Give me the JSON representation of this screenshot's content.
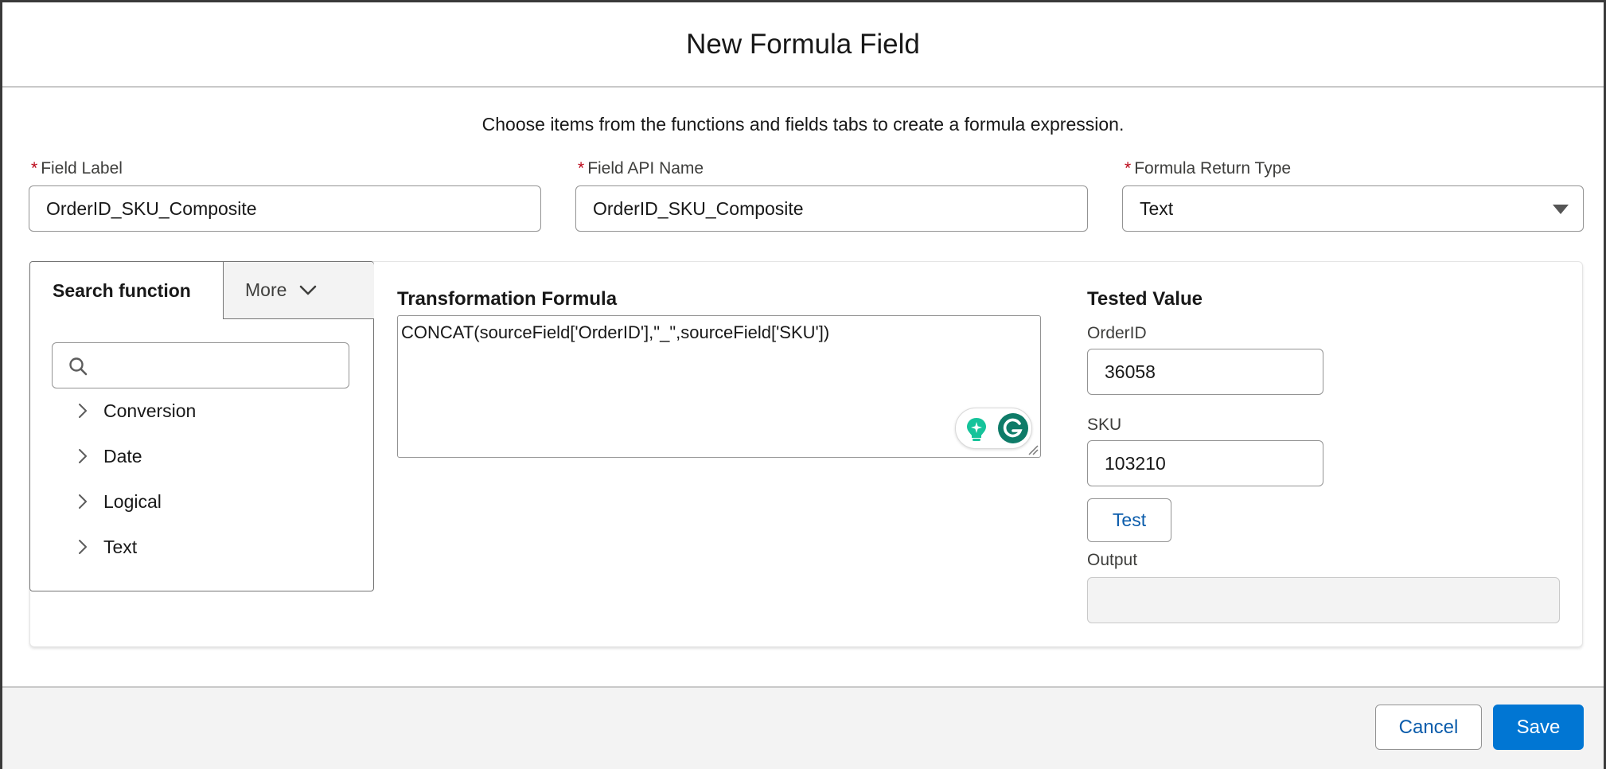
{
  "modal": {
    "title": "New Formula Field",
    "instructions": "Choose items from the functions and fields tabs to create a formula expression."
  },
  "fields": {
    "required_marker": "*",
    "field_label": {
      "label": "Field Label",
      "value": "OrderID_SKU_Composite"
    },
    "field_api_name": {
      "label": "Field API Name",
      "value": "OrderID_SKU_Composite"
    },
    "return_type": {
      "label": "Formula Return Type",
      "value": "Text"
    }
  },
  "functions_panel": {
    "tab_search": "Search function",
    "tab_more": "More",
    "search_value": "",
    "categories": [
      "Conversion",
      "Date",
      "Logical",
      "Text"
    ]
  },
  "formula": {
    "title": "Transformation Formula",
    "value": "CONCAT(sourceField['OrderID'],\"_\",sourceField['SKU'])"
  },
  "tested_value": {
    "title": "Tested Value",
    "orderid_label": "OrderID",
    "orderid_value": "36058",
    "sku_label": "SKU",
    "sku_value": "103210",
    "test_button": "Test",
    "output_label": "Output",
    "output_value": ""
  },
  "footer": {
    "cancel": "Cancel",
    "save": "Save"
  },
  "colors": {
    "brand_button": "#0176d3",
    "link_text": "#0b5cab",
    "required": "#ba0517",
    "grammarly": "#15c39a"
  },
  "icons": {
    "tab_more": "chevron-down-icon",
    "search": "search-icon",
    "tree": "chevron-right-icon",
    "select": "caret-down-icon"
  }
}
